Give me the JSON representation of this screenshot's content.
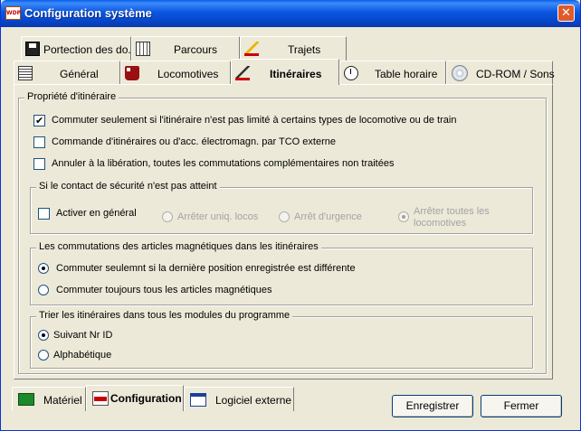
{
  "window": {
    "app_icon_text": "WDP",
    "title": "Configuration système",
    "close_glyph": "✕"
  },
  "top_tabs_row1": [
    {
      "label": "Portection des do...",
      "icon": "document-save-icon"
    },
    {
      "label": "Parcours",
      "icon": "route-grid-icon"
    },
    {
      "label": "Trajets",
      "icon": "pencil-track-icon"
    }
  ],
  "top_tabs_row2": [
    {
      "label": "Général",
      "icon": "list-icon"
    },
    {
      "label": "Locomotives",
      "icon": "locomotive-icon"
    },
    {
      "label": "Itinéraires",
      "icon": "itinerary-icon",
      "active": true
    },
    {
      "label": "Table horaire",
      "icon": "clock-icon"
    },
    {
      "label": "CD-ROM / Sons",
      "icon": "cd-icon"
    }
  ],
  "itinerary": {
    "group_title": "Propriété d'itinéraire",
    "options": [
      {
        "label": "Commuter seulement si l'itinéraire n'est pas limité à certains types de locomotive ou de train",
        "checked": true
      },
      {
        "label": "Commande d'itinéraires ou d'acc. électromagn. par TCO externe",
        "checked": false
      },
      {
        "label": "Annuler à la libération, toutes les commutations complémentaires non traitées",
        "checked": false
      }
    ],
    "safety": {
      "title": "Si le contact de sécurité n'est pas atteint",
      "activate_label": "Activer en général",
      "radio1": "Arrêter uniq. locos",
      "radio2": "Arrêt d'urgence",
      "radio3_line1": "Arrêter toutes les",
      "radio3_line2": "locomotives"
    },
    "magnetic": {
      "title": "Les commutations des articles magnétiques dans les itinéraires",
      "opt1": "Commuter seulemnt si la dernière position enregistrée est différente",
      "opt2": "Commuter toujours tous les articles magnétiques"
    },
    "sort": {
      "title": "Trier les itinéraires dans tous les modules du programme",
      "opt1": "Suivant Nr ID",
      "opt2": "Alphabétique"
    }
  },
  "bottom_tabs": [
    {
      "label": "Matériel"
    },
    {
      "label": "Configuration",
      "active": true
    },
    {
      "label": "Logiciel externe"
    }
  ],
  "buttons": {
    "save": "Enregistrer",
    "close": "Fermer"
  }
}
